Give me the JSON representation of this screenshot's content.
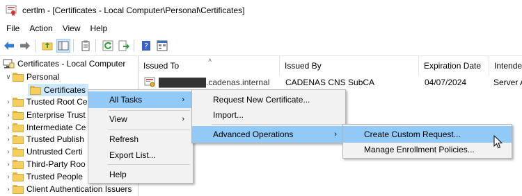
{
  "window": {
    "title": "certlm - [Certificates - Local Computer\\Personal\\Certificates]"
  },
  "menubar": {
    "items": [
      "File",
      "Action",
      "View",
      "Help"
    ]
  },
  "toolbar": {
    "buttons": [
      "back-arrow-icon",
      "forward-arrow-icon",
      "up-folder-icon",
      "show-hide-tree-icon",
      "export-list-icon",
      "refresh-icon",
      "export-icon",
      "help-icon",
      "properties-icon"
    ]
  },
  "tree": {
    "root": "Certificates - Local Computer",
    "personal": "Personal",
    "certificates": "Certificates",
    "items": [
      "Trusted Root Ce",
      "Enterprise Trust",
      "Intermediate Ce",
      "Trusted Publish",
      "Untrusted Certi",
      "Third-Party Roo",
      "Trusted People",
      "Client Authentication Issuers"
    ]
  },
  "list": {
    "columns": [
      "Issued To",
      "Issued By",
      "Expiration Date",
      "Intende"
    ],
    "rows": [
      {
        "issued_to": "████████.cadenas.internal",
        "issued_by": "CADENAS CNS SubCA",
        "expiration": "04/07/2024",
        "intended": "Server A"
      }
    ]
  },
  "context_menu": {
    "all_tasks": "All Tasks",
    "view": "View",
    "refresh": "Refresh",
    "export_list": "Export List...",
    "help": "Help"
  },
  "all_tasks_menu": {
    "request_new": "Request New Certificate...",
    "import": "Import...",
    "advanced": "Advanced Operations"
  },
  "advanced_menu": {
    "create_custom": "Create Custom Request...",
    "manage_policies": "Manage Enrollment Policies..."
  },
  "colors": {
    "highlight": "#91c9f7",
    "selection": "#cce8ff",
    "menu_bg": "#f2f2f2"
  }
}
